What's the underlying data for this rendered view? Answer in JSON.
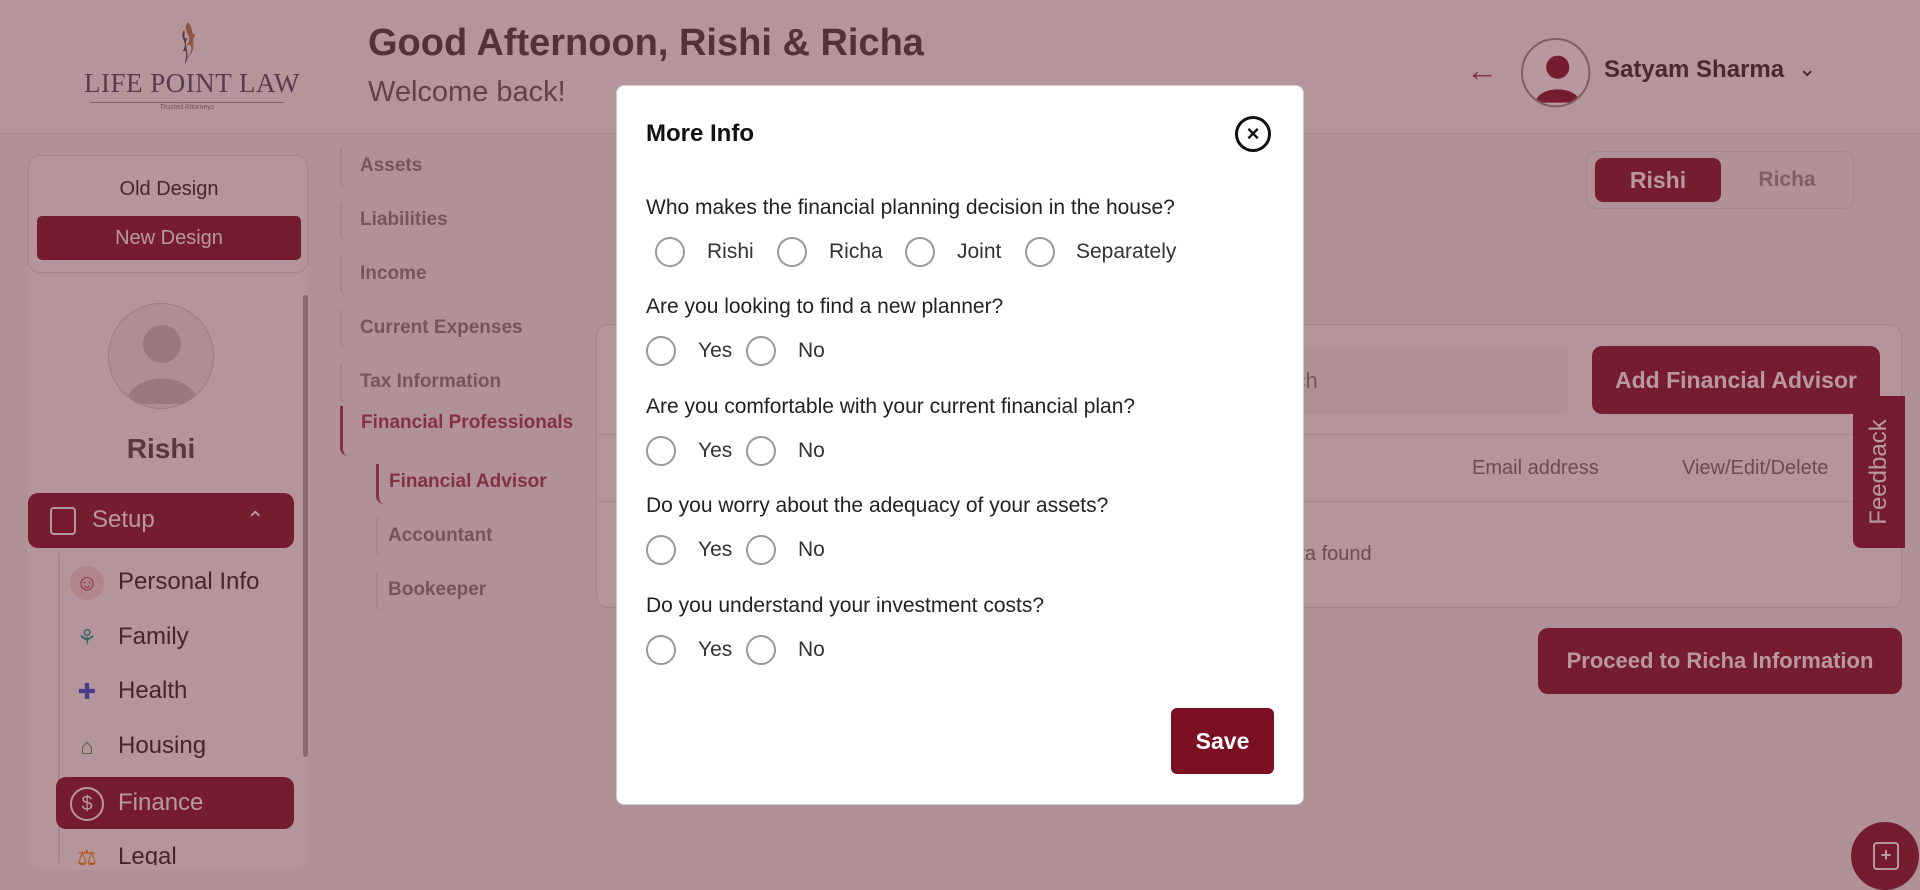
{
  "header": {
    "logo_text": "LIFE POINT LAW",
    "logo_tagline": "Trusted Attorneys",
    "greeting": "Good Afternoon, Rishi & Richa",
    "welcome": "Welcome back!",
    "user_name": "Satyam Sharma"
  },
  "sidebar": {
    "old_design": "Old Design",
    "new_design": "New Design",
    "profile_name": "Rishi",
    "setup_label": "Setup",
    "items": [
      {
        "label": "Personal Info",
        "icon": "person-icon"
      },
      {
        "label": "Family",
        "icon": "family-icon"
      },
      {
        "label": "Health",
        "icon": "health-icon"
      },
      {
        "label": "Housing",
        "icon": "house-icon"
      },
      {
        "label": "Finance",
        "icon": "dollar-icon",
        "active": true
      },
      {
        "label": "Legal",
        "icon": "legal-icon"
      }
    ]
  },
  "subnav": {
    "items": [
      "Assets",
      "Liabilities",
      "Income",
      "Current Expenses",
      "Tax Information",
      "Financial Professionals"
    ],
    "children": [
      "Financial Advisor",
      "Accountant",
      "Bookeeper"
    ]
  },
  "person_toggle": {
    "left": "Rishi",
    "right": "Richa"
  },
  "content": {
    "search_placeholder": "Search",
    "add_button": "Add Financial Advisor",
    "col_email": "Email address",
    "col_actions": "View/Edit/Delete",
    "empty_text": "No data found",
    "proceed_button": "Proceed to Richa Information",
    "feedback": "Feedback"
  },
  "modal": {
    "title": "More Info",
    "questions": [
      {
        "text": "Who makes the financial planning decision in the house?",
        "options": [
          "Rishi",
          "Richa",
          "Joint",
          "Separately"
        ]
      },
      {
        "text": "Are you looking to find a new planner?",
        "options": [
          "Yes",
          "No"
        ]
      },
      {
        "text": "Are you comfortable with your current financial plan?",
        "options": [
          "Yes",
          "No"
        ]
      },
      {
        "text": "Do you worry about the adequacy of your assets?",
        "options": [
          "Yes",
          "No"
        ]
      },
      {
        "text": "Do you understand your investment costs?",
        "options": [
          "Yes",
          "No"
        ]
      }
    ],
    "save_label": "Save"
  },
  "colors": {
    "brand": "#8a2238",
    "brand_dark": "#7b1023",
    "overlay": "rgba(90,20,35,0.44)"
  }
}
